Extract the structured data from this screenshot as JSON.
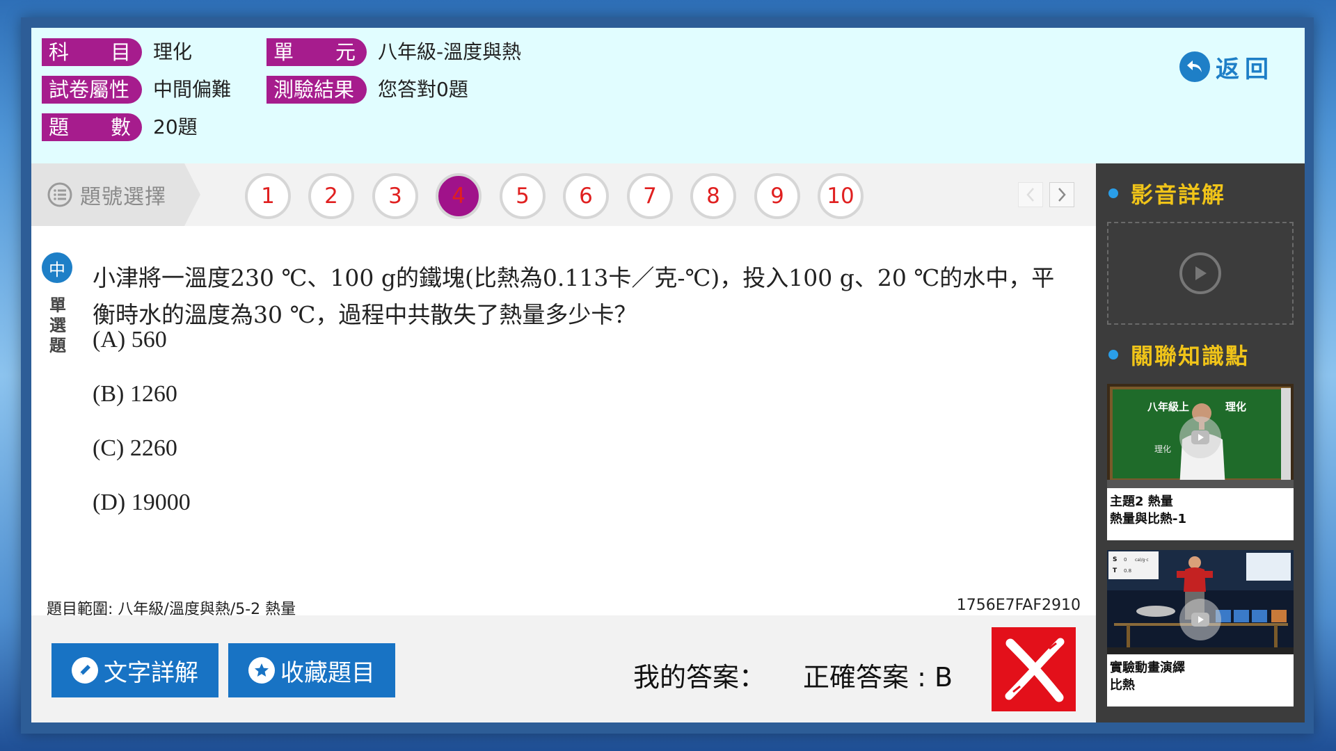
{
  "header": {
    "rows": [
      {
        "label": "科目",
        "value": "理化"
      },
      {
        "label": "試卷屬性",
        "value": "中間偏難"
      },
      {
        "label": "題數",
        "value": "20題"
      },
      {
        "label": "單元",
        "value": "八年級-溫度與熱"
      },
      {
        "label": "測驗結果",
        "value": "您答對0題"
      }
    ],
    "back_label": "返回"
  },
  "qnav": {
    "select_label": "題號選擇",
    "numbers": [
      "1",
      "2",
      "3",
      "4",
      "5",
      "6",
      "7",
      "8",
      "9",
      "10"
    ],
    "active_index": 3
  },
  "question": {
    "level": "中",
    "type": "單選題",
    "text_line1": "小津將一溫度230 ℃、100 g的鐵塊(比熱為0.113卡／克-℃)，投入100 g、20 ℃的水中，平",
    "text_line2": "衡時水的溫度為30 ℃，過程中共散失了熱量多少卡？",
    "options": [
      "(A) 560",
      "(B) 1260",
      "(C) 2260",
      "(D) 19000"
    ],
    "scope": "題目範圍: 八年級/溫度與熱/5-2 熱量",
    "code": "1756E7FAF2910"
  },
  "footer": {
    "explain_label": "文字詳解",
    "favorite_label": "收藏題目",
    "my_answer_label": "我的答案：",
    "correct_answer_label": "正確答案 : B",
    "result": "wrong"
  },
  "sidebar": {
    "video_title": "影音詳解",
    "related_title": "關聯知識點",
    "cards": [
      {
        "line1": "主題2 熱量",
        "line2": "熱量與比熱-1",
        "board_left": "八年級上",
        "board_right": "理化",
        "board_sub": "理化"
      },
      {
        "line1": "實驗動畫演繹",
        "line2": "比熱",
        "panel_s": "S",
        "panel_t": "T",
        "panel_v1": "0",
        "panel_v2": "0.8",
        "panel_unit": "cal/g·c"
      }
    ]
  },
  "colors": {
    "accent_purple": "#a61c8d",
    "accent_blue": "#1e7fc7",
    "wrong_red": "#e3101a",
    "side_gold": "#f0c419"
  }
}
